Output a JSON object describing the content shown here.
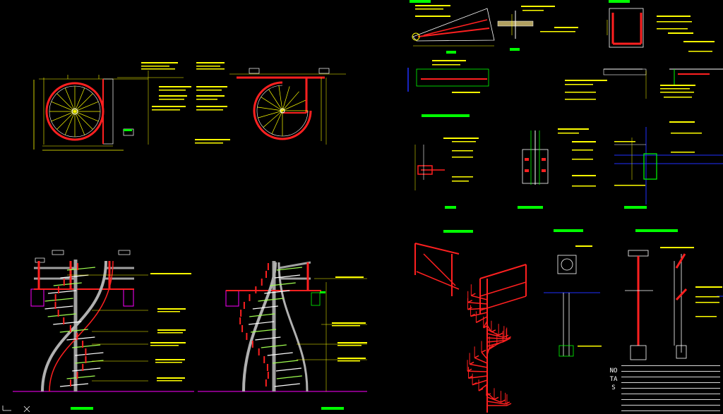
{
  "drawing": {
    "notes_heading": "NOTAS",
    "colors": {
      "background": "#000000",
      "stringer": "#ff2020",
      "dimension": "#ffff00",
      "title_bar": "#00ff00",
      "steps": "#ffffff",
      "section_mark": "#ff00ff",
      "grid": "#2030ff"
    },
    "icons": [
      "ucs-icon"
    ]
  }
}
